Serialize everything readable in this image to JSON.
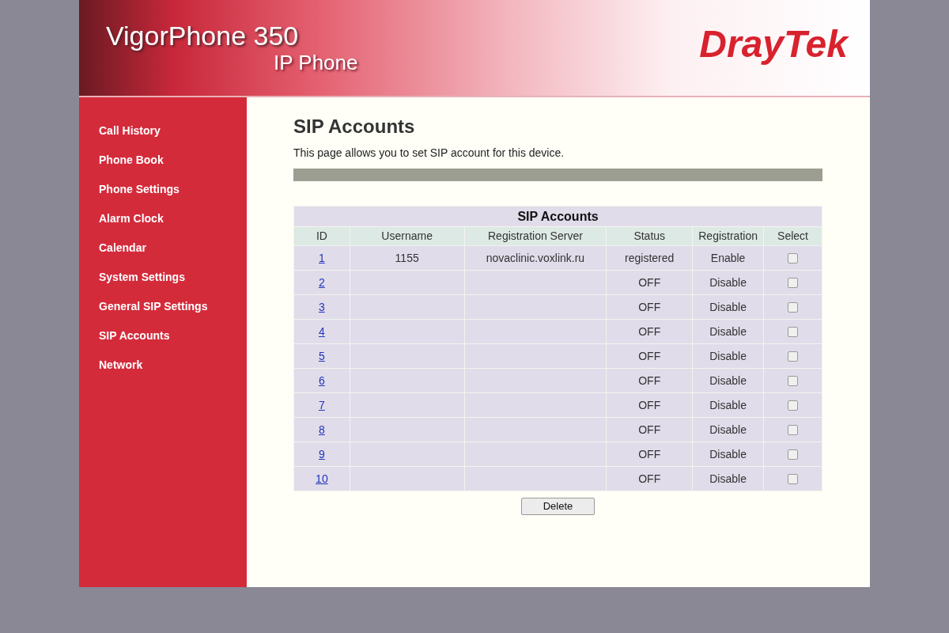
{
  "header": {
    "product": "VigorPhone 350",
    "subtitle": "IP Phone",
    "brand": "DrayTek"
  },
  "sidebar": {
    "items": [
      {
        "label": "Call History"
      },
      {
        "label": "Phone Book"
      },
      {
        "label": "Phone Settings"
      },
      {
        "label": "Alarm Clock"
      },
      {
        "label": "Calendar"
      },
      {
        "label": "System Settings"
      },
      {
        "label": "General SIP Settings"
      },
      {
        "label": "SIP Accounts"
      },
      {
        "label": "Network"
      }
    ]
  },
  "page": {
    "title": "SIP Accounts",
    "description": "This page allows you to set SIP account for this device."
  },
  "table": {
    "caption": "SIP Accounts",
    "columns": [
      "ID",
      "Username",
      "Registration Server",
      "Status",
      "Registration",
      "Select"
    ],
    "rows": [
      {
        "id": "1",
        "username": "1155",
        "server": "novaclinic.voxlink.ru",
        "status": "registered",
        "registration": "Enable",
        "checked": false
      },
      {
        "id": "2",
        "status": "OFF",
        "registration": "Disable",
        "checked": false
      },
      {
        "id": "3",
        "status": "OFF",
        "registration": "Disable",
        "checked": false
      },
      {
        "id": "4",
        "status": "OFF",
        "registration": "Disable",
        "checked": false
      },
      {
        "id": "5",
        "status": "OFF",
        "registration": "Disable",
        "checked": false
      },
      {
        "id": "6",
        "status": "OFF",
        "registration": "Disable",
        "checked": false
      },
      {
        "id": "7",
        "status": "OFF",
        "registration": "Disable",
        "checked": false
      },
      {
        "id": "8",
        "status": "OFF",
        "registration": "Disable",
        "checked": false
      },
      {
        "id": "9",
        "status": "OFF",
        "registration": "Disable",
        "checked": false
      },
      {
        "id": "10",
        "status": "OFF",
        "registration": "Disable",
        "checked": false
      }
    ]
  },
  "buttons": [
    "Delete"
  ]
}
